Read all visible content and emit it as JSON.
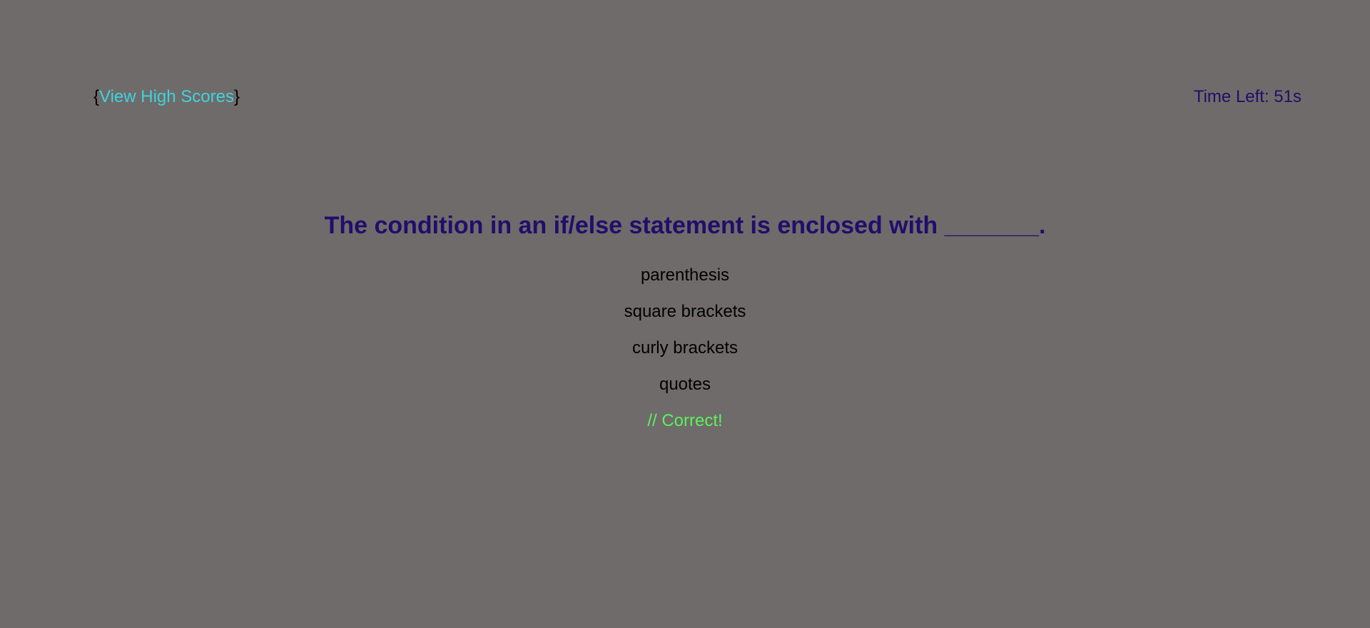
{
  "header": {
    "brace_open": "{",
    "high_scores_label": "View High Scores",
    "brace_close": "}",
    "timer_label": "Time Left: 51s"
  },
  "quiz": {
    "question": "The condition in an if/else statement is enclosed with _______.",
    "choices": [
      {
        "label": "parenthesis"
      },
      {
        "label": "square brackets"
      },
      {
        "label": "curly brackets"
      },
      {
        "label": "quotes"
      }
    ],
    "feedback": "// Correct!"
  },
  "colors": {
    "background": "#6f6b6a",
    "link": "#3fd3dd",
    "question": "#1e0f6b",
    "correct": "#5cf25c"
  }
}
